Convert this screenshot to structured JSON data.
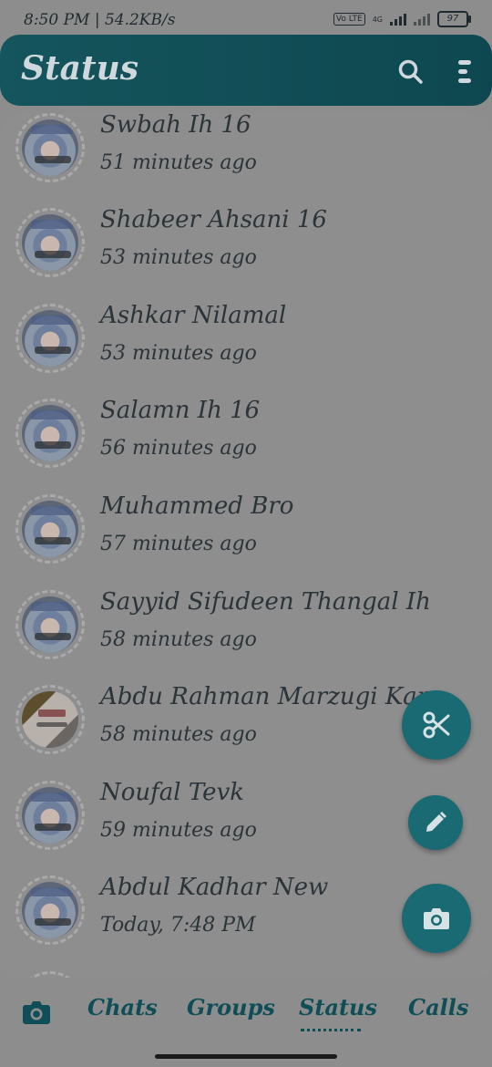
{
  "statusbar": {
    "time": "8:50 PM | 54.2KB/s",
    "network_badge": "Vo LTE",
    "network_type": "4G",
    "battery": "97"
  },
  "appbar": {
    "title": "Status",
    "search_icon": "search-icon",
    "menu_icon": "more-vertical-icon"
  },
  "statuses": [
    {
      "name": "Swbah Ih 16",
      "time": "51 minutes ago"
    },
    {
      "name": "Shabeer Ahsani 16",
      "time": "53 minutes ago"
    },
    {
      "name": "Ashkar Nilamal",
      "time": "53 minutes ago"
    },
    {
      "name": "Salamn Ih 16",
      "time": "56 minutes ago"
    },
    {
      "name": "Muhammed Bro",
      "time": "57 minutes ago"
    },
    {
      "name": "Sayyid Sifudeen Thangal Ih",
      "time": "58 minutes ago"
    },
    {
      "name": "Abdu Rahman Marzugi Karı",
      "time": "58 minutes ago"
    },
    {
      "name": "Noufal Tevk",
      "time": "59 minutes ago"
    },
    {
      "name": "Abdul Kadhar New",
      "time": "Today, 7:48 PM"
    }
  ],
  "fabs": {
    "cut_icon": "scissors-icon",
    "edit_icon": "pencil-icon",
    "camera_icon": "camera-icon"
  },
  "bottom_nav": {
    "camera_icon": "camera-icon",
    "tabs": [
      "Chats",
      "Groups",
      "Status",
      "Calls"
    ],
    "active": "Status"
  },
  "colors": {
    "accent": "#1a6a73",
    "appbar": "#15555d",
    "tab_text": "#0f4e57"
  }
}
